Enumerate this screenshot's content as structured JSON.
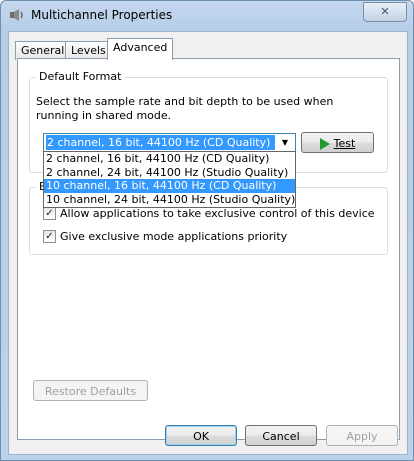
{
  "window": {
    "title": "Multichannel Properties",
    "close_glyph": "✕"
  },
  "tabs": [
    {
      "label": "General"
    },
    {
      "label": "Levels"
    },
    {
      "label": "Advanced"
    }
  ],
  "default_format": {
    "legend": "Default Format",
    "description": "Select the sample rate and bit depth to be used when running in shared mode.",
    "selected": "2 channel, 16 bit, 44100 Hz (CD Quality)",
    "options": [
      "2 channel, 16 bit, 44100 Hz (CD Quality)",
      "2 channel, 24 bit, 44100 Hz (Studio Quality)",
      "10 channel, 16 bit, 44100 Hz (CD Quality)",
      "10 channel, 24 bit, 44100 Hz (Studio Quality)"
    ],
    "highlighted_option_index": 2,
    "test_button": "Test"
  },
  "exclusive_mode": {
    "legend_partial": "E",
    "allow_exclusive": {
      "label": "Allow applications to take exclusive control of this device",
      "checked": true
    },
    "give_priority": {
      "label": "Give exclusive mode applications priority",
      "checked": true
    }
  },
  "restore_defaults": "Restore Defaults",
  "footer": {
    "ok": "OK",
    "cancel": "Cancel",
    "apply": "Apply"
  },
  "colors": {
    "selection": "#3399ff",
    "play_icon": "#1f9a2c"
  }
}
